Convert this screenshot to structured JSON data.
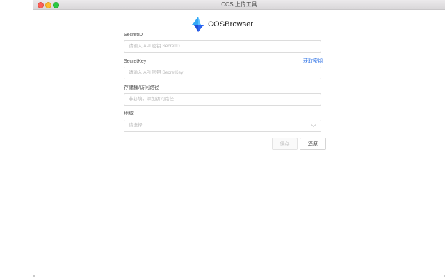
{
  "window": {
    "title": "COS 上传工具"
  },
  "brand": {
    "name": "COSBrowser"
  },
  "form": {
    "secret_id": {
      "label": "SecretID",
      "placeholder": "请输入 API 密钥 SecretID"
    },
    "secret_key": {
      "label": "SecretKey",
      "placeholder": "请输入 API 密钥 SecretKey",
      "link": "获取密钥"
    },
    "path": {
      "label": "存储桶/访问路径",
      "placeholder": "非必填，添加访问路径"
    },
    "region": {
      "label": "地域",
      "placeholder": "请选择"
    }
  },
  "buttons": {
    "save": "保存",
    "reset": "还原"
  },
  "colors": {
    "link": "#2f73e6",
    "logo_light": "#35a8f5",
    "logo_dark": "#1e4fd8"
  }
}
